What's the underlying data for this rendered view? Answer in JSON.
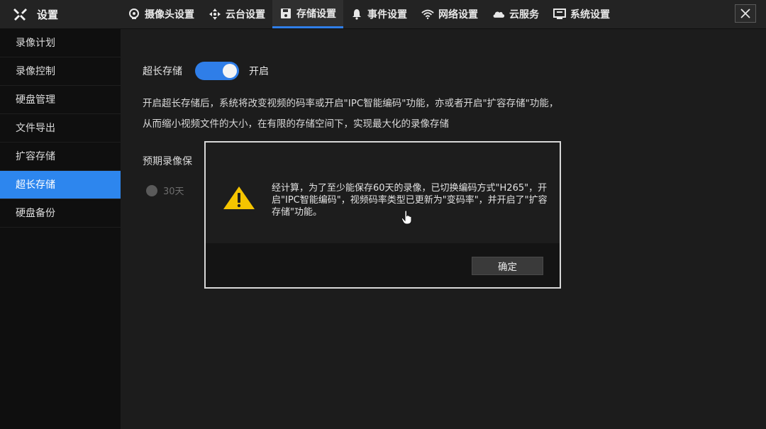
{
  "header": {
    "title": "设置",
    "tabs": [
      {
        "label": "摄像头设置",
        "icon": "camera-icon"
      },
      {
        "label": "云台设置",
        "icon": "ptz-arrows-icon"
      },
      {
        "label": "存储设置",
        "icon": "save-disk-icon"
      },
      {
        "label": "事件设置",
        "icon": "bell-icon"
      },
      {
        "label": "网络设置",
        "icon": "wifi-icon"
      },
      {
        "label": "云服务",
        "icon": "cloud-icon"
      },
      {
        "label": "系统设置",
        "icon": "monitor-icon"
      }
    ],
    "active_tab": "存储设置"
  },
  "sidebar": {
    "items": [
      {
        "label": "录像计划"
      },
      {
        "label": "录像控制"
      },
      {
        "label": "硬盘管理"
      },
      {
        "label": "文件导出"
      },
      {
        "label": "扩容存储"
      },
      {
        "label": "超长存储"
      },
      {
        "label": "硬盘备份"
      }
    ],
    "active": "超长存储"
  },
  "main": {
    "toggle_label": "超长存储",
    "toggle_state_text": "开启",
    "toggle_on": true,
    "desc_line1": "开启超长存储后，系统将改变视频的码率或开启\"IPC智能编码\"功能，亦或者开启\"扩容存储\"功能，",
    "desc_line2": "从而缩小视频文件的大小，在有限的存储空间下，实现最大化的录像存储",
    "expect_label": "预期录像保",
    "radio_option": "30天"
  },
  "dialog": {
    "message": "经计算，为了至少能保存60天的录像，已切换编码方式\"H265\"，开启\"IPC智能编码\"，视频码率类型已更新为\"变码率\"，并开启了\"扩容存储\"功能。",
    "confirm_label": "确定"
  },
  "colors": {
    "accent": "#2f7ee8",
    "warning": "#f5c400"
  }
}
